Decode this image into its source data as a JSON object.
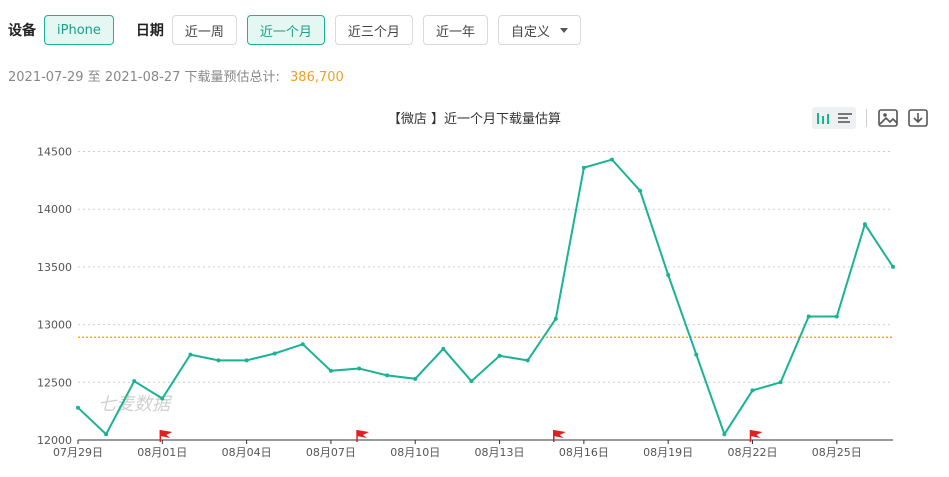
{
  "filters": {
    "device_label": "设备",
    "device_value": "iPhone",
    "date_label": "日期",
    "ranges": [
      "近一周",
      "近一个月",
      "近三个月",
      "近一年"
    ],
    "active_range": 1,
    "custom_label": "自定义"
  },
  "summary": {
    "text": "2021-07-29 至 2021-08-27 下载量预估总计:",
    "total": "386,700"
  },
  "chart_data": {
    "type": "line",
    "title": "【微店 】近一个月下载量估算",
    "watermark": "七麦数据",
    "x_tick_labels": [
      "07月29日",
      "08月01日",
      "08月04日",
      "08月07日",
      "08月10日",
      "08月13日",
      "08月16日",
      "08月19日",
      "08月22日",
      "08月25日"
    ],
    "y_ticks": [
      12000,
      12500,
      13000,
      13500,
      14000,
      14500
    ],
    "ylim": [
      12000,
      14600
    ],
    "average": 12890,
    "x": [
      "07-29",
      "07-30",
      "07-31",
      "08-01",
      "08-02",
      "08-03",
      "08-04",
      "08-05",
      "08-06",
      "08-07",
      "08-08",
      "08-09",
      "08-10",
      "08-11",
      "08-12",
      "08-13",
      "08-14",
      "08-15",
      "08-16",
      "08-17",
      "08-18",
      "08-19",
      "08-20",
      "08-21",
      "08-22",
      "08-23",
      "08-24",
      "08-25",
      "08-26",
      "08-27"
    ],
    "values": [
      12280,
      12050,
      12510,
      12360,
      12740,
      12690,
      12690,
      12750,
      12830,
      12600,
      12620,
      12560,
      12530,
      12790,
      12510,
      12730,
      12690,
      13050,
      14360,
      14430,
      14160,
      13430,
      12740,
      12050,
      12430,
      12500,
      13070,
      13070,
      13870,
      13500
    ],
    "flags": [
      "08-01",
      "08-08",
      "08-15",
      "08-22"
    ],
    "line_color": "#1ab394",
    "average_color": "#f0b400",
    "flag_color": "#e02020"
  }
}
